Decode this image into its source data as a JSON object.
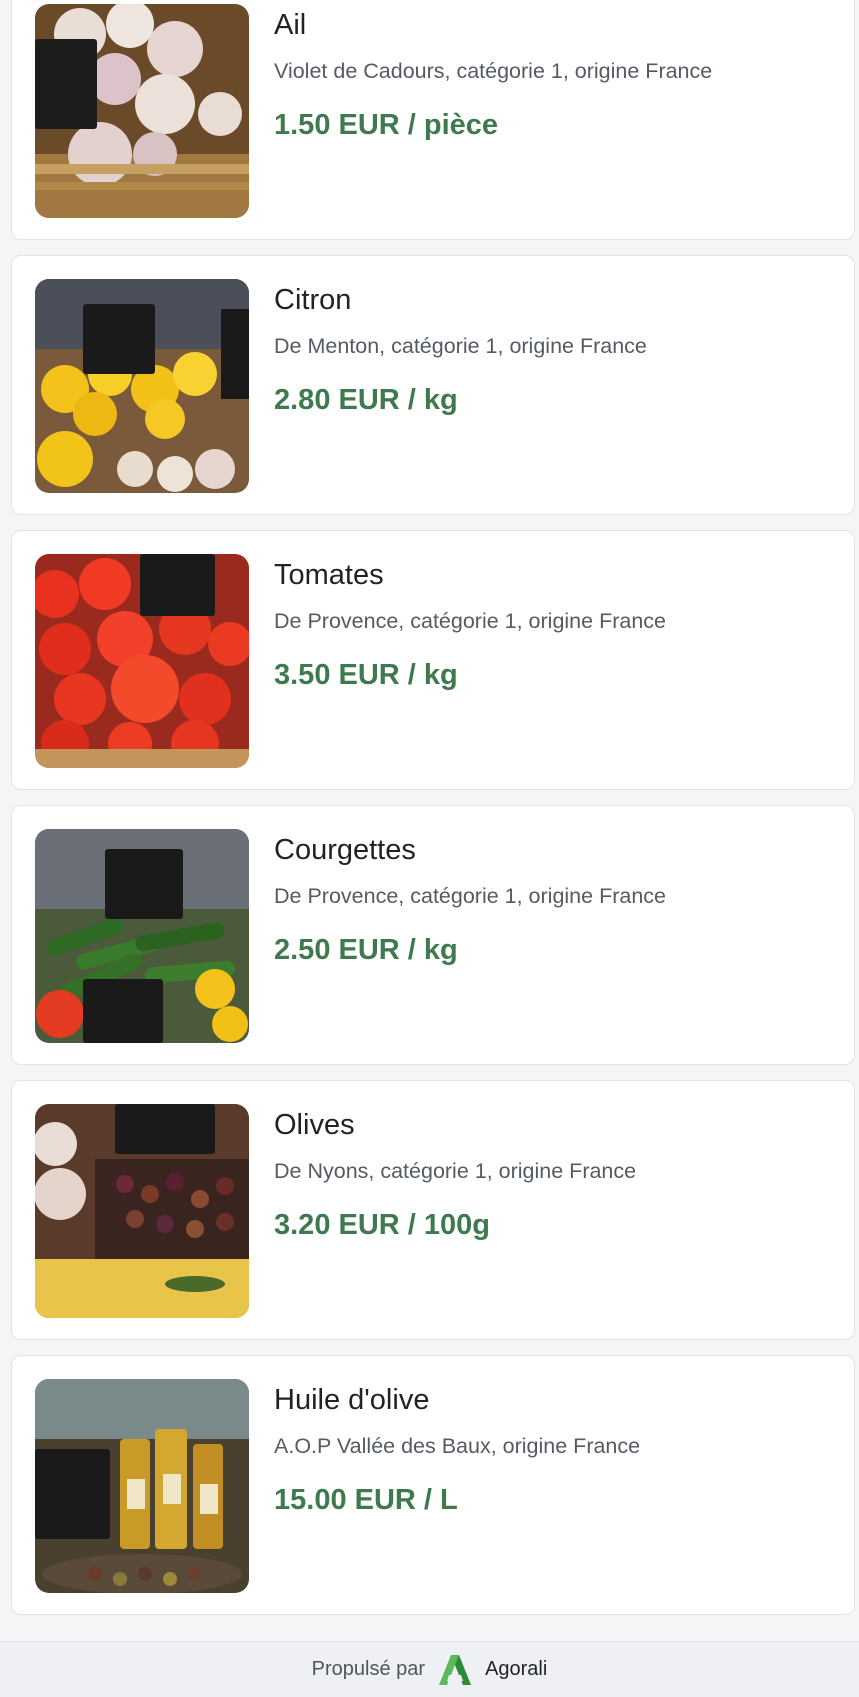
{
  "products": [
    {
      "name": "Ail",
      "description": "Violet de Cadours, catégorie 1, origine France",
      "price": "1.50 EUR / pièce",
      "image": "garlic-photo"
    },
    {
      "name": "Citron",
      "description": "De Menton, catégorie 1, origine France",
      "price": "2.80 EUR / kg",
      "image": "lemon-photo"
    },
    {
      "name": "Tomates",
      "description": "De Provence, catégorie 1, origine France",
      "price": "3.50 EUR / kg",
      "image": "tomato-photo"
    },
    {
      "name": "Courgettes",
      "description": "De Provence, catégorie 1, origine France",
      "price": "2.50 EUR / kg",
      "image": "zucchini-photo"
    },
    {
      "name": "Olives",
      "description": "De Nyons, catégorie 1, origine France",
      "price": "3.20 EUR / 100g",
      "image": "olives-photo"
    },
    {
      "name": "Huile d'olive",
      "description": "A.O.P Vallée des Baux, origine France",
      "price": "15.00 EUR / L",
      "image": "olive-oil-photo"
    }
  ],
  "footer": {
    "powered_by": "Propulsé par",
    "brand": "Agorali",
    "logo_icon": "agorali-logo-icon"
  },
  "colors": {
    "price": "#3f7a4f",
    "background": "#f4f5f7",
    "card": "#ffffff"
  }
}
